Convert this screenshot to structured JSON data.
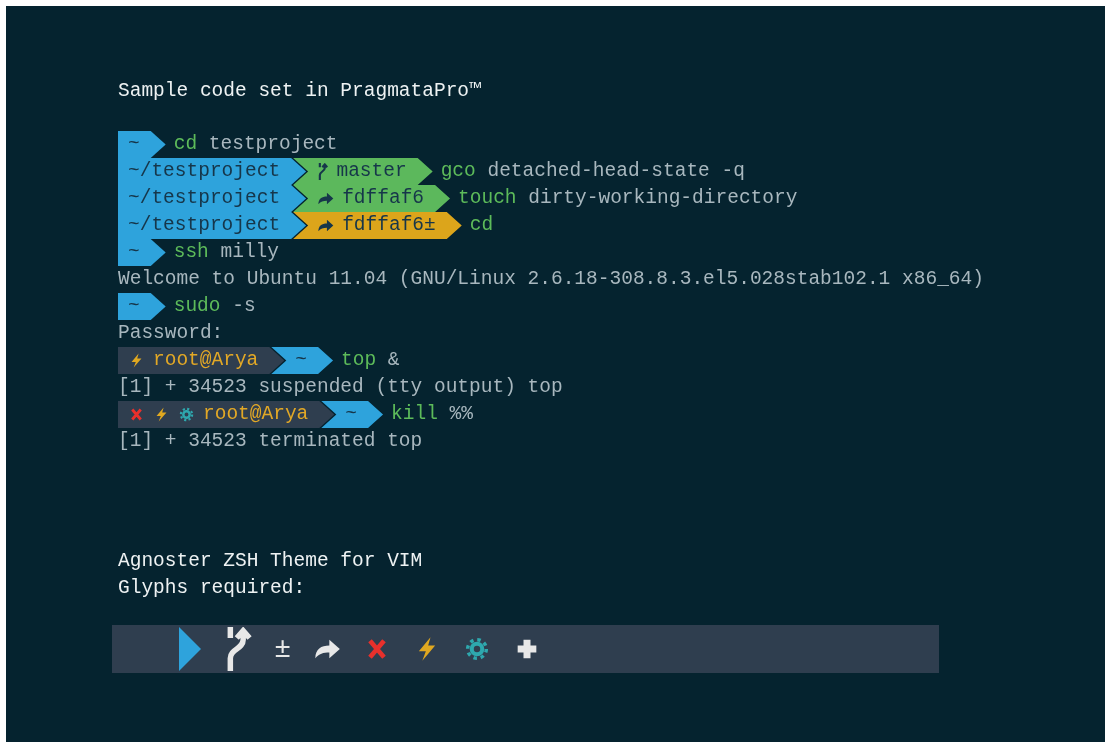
{
  "title": "Sample code set in PragmataPro™",
  "lines": [
    {
      "kind": "prompt",
      "segments": [
        {
          "kind": "path",
          "text": "~"
        }
      ],
      "command": "cd",
      "args": "testproject"
    },
    {
      "kind": "prompt",
      "segments": [
        {
          "kind": "path",
          "text": "~/testproject"
        },
        {
          "kind": "git-clean",
          "icons": [
            {
              "kind": "branch"
            }
          ],
          "text": "master"
        }
      ],
      "command": "gco",
      "args": "detached-head-state -q"
    },
    {
      "kind": "prompt",
      "segments": [
        {
          "kind": "path",
          "text": "~/testproject"
        },
        {
          "kind": "git-clean",
          "icons": [
            {
              "kind": "arrow"
            }
          ],
          "text": "fdffaf6"
        }
      ],
      "command": "touch",
      "args": "dirty-working-directory"
    },
    {
      "kind": "prompt",
      "segments": [
        {
          "kind": "path",
          "text": "~/testproject"
        },
        {
          "kind": "git-dirty",
          "icons": [
            {
              "kind": "arrow"
            }
          ],
          "text": "fdffaf6±"
        }
      ],
      "command": "cd"
    },
    {
      "kind": "prompt",
      "segments": [
        {
          "kind": "path",
          "text": "~"
        }
      ],
      "command": "ssh",
      "args": "milly"
    },
    {
      "kind": "output",
      "text": "Welcome to Ubuntu 11.04 (GNU/Linux 2.6.18-308.8.3.el5.028stab102.1 x86_64)"
    },
    {
      "kind": "prompt",
      "segments": [
        {
          "kind": "path",
          "text": "~"
        }
      ],
      "command": "sudo",
      "args": "-s"
    },
    {
      "kind": "output",
      "text": "Password:"
    },
    {
      "kind": "prompt",
      "segments": [
        {
          "kind": "context",
          "icons": [
            {
              "kind": "bolt"
            }
          ],
          "text": "root@Arya"
        },
        {
          "kind": "path",
          "text": "~"
        }
      ],
      "command": "top",
      "args": "&"
    },
    {
      "kind": "output",
      "text": "[1] + 34523 suspended (tty output) top"
    },
    {
      "kind": "prompt",
      "segments": [
        {
          "kind": "context",
          "icons": [
            {
              "kind": "cross"
            },
            {
              "kind": "bolt"
            },
            {
              "kind": "gear"
            }
          ],
          "text": "root@Arya"
        },
        {
          "kind": "path",
          "text": "~"
        }
      ],
      "command": "kill",
      "args": "%%"
    },
    {
      "kind": "output",
      "text": "[1] + 34523 terminated top"
    }
  ],
  "footer_lines": [
    "Agnoster ZSH Theme for VIM",
    "Glyphs required:"
  ],
  "glyphs": [
    {
      "kind": "triangle"
    },
    {
      "kind": "branch"
    },
    {
      "kind": "text",
      "text": "±"
    },
    {
      "kind": "arrow"
    },
    {
      "kind": "cross"
    },
    {
      "kind": "bolt"
    },
    {
      "kind": "gear"
    },
    {
      "kind": "plus"
    }
  ]
}
